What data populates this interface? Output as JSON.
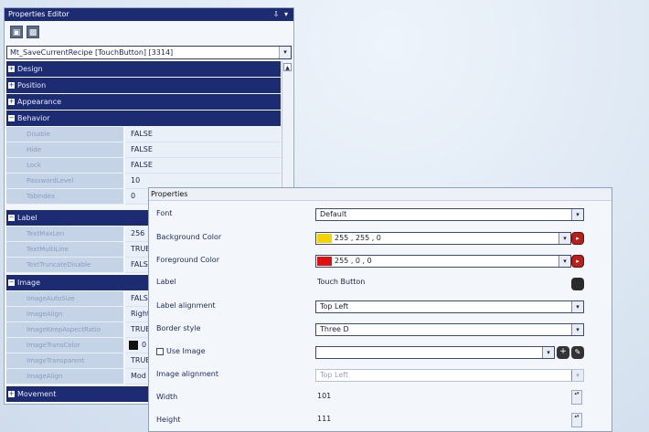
{
  "editor": {
    "title": "Properties Editor",
    "pin_glyph": "⇩",
    "close_glyph": "▾",
    "tool_buttons": [
      "▣",
      "▩"
    ],
    "object_select": "Mt_SaveCurrentRecipe [TouchButton] [3314]",
    "scroll_up": "▲",
    "categories": {
      "design": "Design",
      "position": "Position",
      "appearance": "Appearance",
      "behavior": "Behavior",
      "label": "Label",
      "image": "Image",
      "movement": "Movement"
    },
    "expand_glyph": "+",
    "collapse_glyph": "−",
    "behavior_rows": [
      {
        "name": "Disable",
        "value": "FALSE"
      },
      {
        "name": "Hide",
        "value": "FALSE"
      },
      {
        "name": "Lock",
        "value": "FALSE"
      },
      {
        "name": "PasswordLevel",
        "value": "10"
      },
      {
        "name": "TabIndex",
        "value": "0"
      }
    ],
    "label_rows": [
      {
        "name": "TextMaxLen",
        "value": "256"
      },
      {
        "name": "TextMultiLine",
        "value": "TRUE"
      },
      {
        "name": "TextTruncateDisable",
        "value": "FALSE"
      }
    ],
    "image_rows": [
      {
        "name": "ImageAutoSize",
        "value": "FALSE"
      },
      {
        "name": "ImageAlign",
        "value": "Right"
      },
      {
        "name": "ImageKeepAspectRatio",
        "value": "TRUE"
      },
      {
        "name": "ImageTransColor",
        "value": "0"
      },
      {
        "name": "ImageTransparent",
        "value": "TRUE"
      },
      {
        "name": "ImageAlign",
        "value": "Mod"
      }
    ]
  },
  "properties": {
    "title": "Properties",
    "font": {
      "label": "Font",
      "value": "Default"
    },
    "background_color": {
      "label": "Background Color",
      "value": "255 , 255 , 0",
      "swatch": "#f4d400"
    },
    "foreground_color": {
      "label": "Foreground Color",
      "value": "255 , 0 , 0",
      "swatch": "#e01010"
    },
    "label_field": {
      "label": "Label",
      "value": "Touch Button"
    },
    "label_alignment": {
      "label": "Label alignment",
      "value": "Top Left"
    },
    "border_style": {
      "label": "Border style",
      "value": "Three D"
    },
    "use_image": {
      "label": "Use Image",
      "value": ""
    },
    "image_alignment": {
      "label": "Image alignment",
      "value": "Top Left"
    },
    "width": {
      "label": "Width",
      "value": "101"
    },
    "height": {
      "label": "Height",
      "value": "111"
    },
    "dropdown_glyph": "▾",
    "spin_glyph": "▴▾",
    "plus_glyph": "+",
    "edit_glyph": "✎",
    "pick_glyph": "▸"
  }
}
